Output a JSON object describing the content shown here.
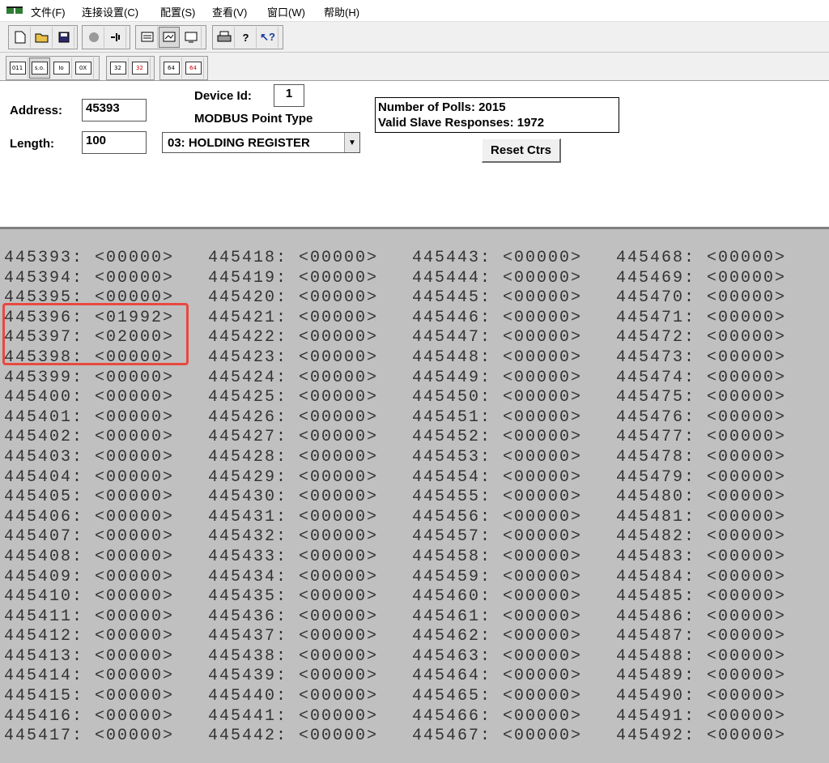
{
  "menu": {
    "items": [
      "文件(F)",
      "连接设置(C)",
      "配置(S)",
      "查看(V)",
      "窗口(W)",
      "帮助(H)"
    ]
  },
  "toolbar1": {
    "icons": [
      "new-icon",
      "open-icon",
      "save-icon",
      "connect-icon",
      "disconnect-icon",
      "poll-icon",
      "view-icon",
      "monitor-icon",
      "print-icon",
      "help-icon",
      "context-help-icon"
    ]
  },
  "toolbar2": {
    "buttons": [
      "011",
      "s.o.",
      "Io",
      "0X",
      "32",
      "32",
      "64",
      "64"
    ]
  },
  "form": {
    "address_label": "Address:",
    "address_value": "45393",
    "length_label": "Length:",
    "length_value": "100",
    "device_id_label": "Device Id:",
    "device_id_value": "1",
    "point_type_label": "MODBUS Point Type",
    "point_type_value": "03: HOLDING REGISTER"
  },
  "stats": {
    "polls": "Number of Polls: 2015",
    "responses": "Valid Slave Responses: 1972"
  },
  "reset_label": "Reset Ctrs",
  "registers": {
    "col1": [
      "445393: <00000>",
      "445394: <00000>",
      "445395: <00000>",
      "445396: <01992>",
      "445397: <02000>",
      "445398: <00000>",
      "445399: <00000>",
      "445400: <00000>",
      "445401: <00000>",
      "445402: <00000>",
      "445403: <00000>",
      "445404: <00000>",
      "445405: <00000>",
      "445406: <00000>",
      "445407: <00000>",
      "445408: <00000>",
      "445409: <00000>",
      "445410: <00000>",
      "445411: <00000>",
      "445412: <00000>",
      "445413: <00000>",
      "445414: <00000>",
      "445415: <00000>",
      "445416: <00000>",
      "445417: <00000>"
    ],
    "col2": [
      "445418: <00000>",
      "445419: <00000>",
      "445420: <00000>",
      "445421: <00000>",
      "445422: <00000>",
      "445423: <00000>",
      "445424: <00000>",
      "445425: <00000>",
      "445426: <00000>",
      "445427: <00000>",
      "445428: <00000>",
      "445429: <00000>",
      "445430: <00000>",
      "445431: <00000>",
      "445432: <00000>",
      "445433: <00000>",
      "445434: <00000>",
      "445435: <00000>",
      "445436: <00000>",
      "445437: <00000>",
      "445438: <00000>",
      "445439: <00000>",
      "445440: <00000>",
      "445441: <00000>",
      "445442: <00000>"
    ],
    "col3": [
      "445443: <00000>",
      "445444: <00000>",
      "445445: <00000>",
      "445446: <00000>",
      "445447: <00000>",
      "445448: <00000>",
      "445449: <00000>",
      "445450: <00000>",
      "445451: <00000>",
      "445452: <00000>",
      "445453: <00000>",
      "445454: <00000>",
      "445455: <00000>",
      "445456: <00000>",
      "445457: <00000>",
      "445458: <00000>",
      "445459: <00000>",
      "445460: <00000>",
      "445461: <00000>",
      "445462: <00000>",
      "445463: <00000>",
      "445464: <00000>",
      "445465: <00000>",
      "445466: <00000>",
      "445467: <00000>"
    ],
    "col4": [
      "445468: <00000>",
      "445469: <00000>",
      "445470: <00000>",
      "445471: <00000>",
      "445472: <00000>",
      "445473: <00000>",
      "445474: <00000>",
      "445475: <00000>",
      "445476: <00000>",
      "445477: <00000>",
      "445478: <00000>",
      "445479: <00000>",
      "445480: <00000>",
      "445481: <00000>",
      "445482: <00000>",
      "445483: <00000>",
      "445484: <00000>",
      "445485: <00000>",
      "445486: <00000>",
      "445487: <00000>",
      "445488: <00000>",
      "445489: <00000>",
      "445490: <00000>",
      "445491: <00000>",
      "445492: <00000>"
    ]
  },
  "colors": {
    "highlight": "#e8493f",
    "data_bg": "#c0c0c0"
  }
}
